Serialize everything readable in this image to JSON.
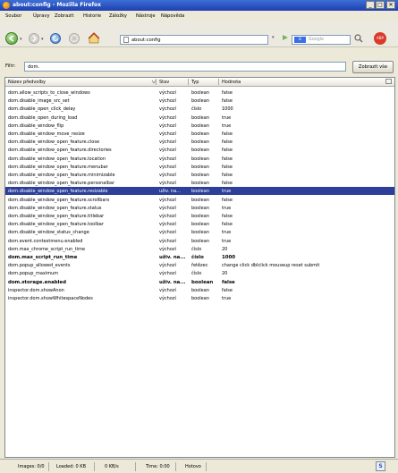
{
  "window": {
    "title": "about:config - Mozilla Firefox",
    "min_label": "_",
    "max_label": "□",
    "close_label": "✕"
  },
  "menu": [
    "Soubor",
    "Úpravy",
    "Zobrazit",
    "Historie",
    "Záložky",
    "Nástroje",
    "Nápověda"
  ],
  "toolbar": {
    "url": "about:config",
    "search_placeholder": "Google",
    "search_engine": "G"
  },
  "filter": {
    "label": "Filtr:",
    "value": "dom.",
    "button": "Zobrazit vše"
  },
  "columns": [
    "Název předvolby",
    "Stav",
    "Typ",
    "Hodnota"
  ],
  "rows": [
    {
      "name": "dom.allow_scripts_to_close_windows",
      "status": "výchozí",
      "type": "boolean",
      "value": "false"
    },
    {
      "name": "dom.disable_image_src_set",
      "status": "výchozí",
      "type": "boolean",
      "value": "false"
    },
    {
      "name": "dom.disable_open_click_delay",
      "status": "výchozí",
      "type": "číslo",
      "value": "1000"
    },
    {
      "name": "dom.disable_open_during_load",
      "status": "výchozí",
      "type": "boolean",
      "value": "true"
    },
    {
      "name": "dom.disable_window_flip",
      "status": "výchozí",
      "type": "boolean",
      "value": "true"
    },
    {
      "name": "dom.disable_window_move_resize",
      "status": "výchozí",
      "type": "boolean",
      "value": "false"
    },
    {
      "name": "dom.disable_window_open_feature.close",
      "status": "výchozí",
      "type": "boolean",
      "value": "false"
    },
    {
      "name": "dom.disable_window_open_feature.directories",
      "status": "výchozí",
      "type": "boolean",
      "value": "false"
    },
    {
      "name": "dom.disable_window_open_feature.location",
      "status": "výchozí",
      "type": "boolean",
      "value": "false"
    },
    {
      "name": "dom.disable_window_open_feature.menubar",
      "status": "výchozí",
      "type": "boolean",
      "value": "false"
    },
    {
      "name": "dom.disable_window_open_feature.minimizable",
      "status": "výchozí",
      "type": "boolean",
      "value": "false"
    },
    {
      "name": "dom.disable_window_open_feature.personalbar",
      "status": "výchozí",
      "type": "boolean",
      "value": "false"
    },
    {
      "name": "dom.disable_window_open_feature.resizable",
      "status": "uživ. na...",
      "type": "boolean",
      "value": "true",
      "selected": true
    },
    {
      "name": "dom.disable_window_open_feature.scrollbars",
      "status": "výchozí",
      "type": "boolean",
      "value": "false"
    },
    {
      "name": "dom.disable_window_open_feature.status",
      "status": "výchozí",
      "type": "boolean",
      "value": "true"
    },
    {
      "name": "dom.disable_window_open_feature.titlebar",
      "status": "výchozí",
      "type": "boolean",
      "value": "false"
    },
    {
      "name": "dom.disable_window_open_feature.toolbar",
      "status": "výchozí",
      "type": "boolean",
      "value": "false"
    },
    {
      "name": "dom.disable_window_status_change",
      "status": "výchozí",
      "type": "boolean",
      "value": "true"
    },
    {
      "name": "dom.event.contextmenu.enabled",
      "status": "výchozí",
      "type": "boolean",
      "value": "true"
    },
    {
      "name": "dom.max_chrome_script_run_time",
      "status": "výchozí",
      "type": "číslo",
      "value": "20"
    },
    {
      "name": "dom.max_script_run_time",
      "status": "uživ. na...",
      "type": "číslo",
      "value": "1000",
      "bold": true
    },
    {
      "name": "dom.popup_allowed_events",
      "status": "výchozí",
      "type": "řetězec",
      "value": "change click dblclick mouseup reset submit"
    },
    {
      "name": "dom.popup_maximum",
      "status": "výchozí",
      "type": "číslo",
      "value": "20"
    },
    {
      "name": "dom.storage.enabled",
      "status": "uživ. na...",
      "type": "boolean",
      "value": "false",
      "bold": true
    },
    {
      "name": "inspector.dom.showAnon",
      "status": "výchozí",
      "type": "boolean",
      "value": "false"
    },
    {
      "name": "inspector.dom.showWhitespaceNodes",
      "status": "výchozí",
      "type": "boolean",
      "value": "true"
    }
  ],
  "status": {
    "images": "Images: 0/0",
    "loaded": "Loaded: 0 KB",
    "speed": "0 KB/s",
    "time": "Time: 0:00",
    "state": "Hotovo",
    "icon": "S"
  }
}
